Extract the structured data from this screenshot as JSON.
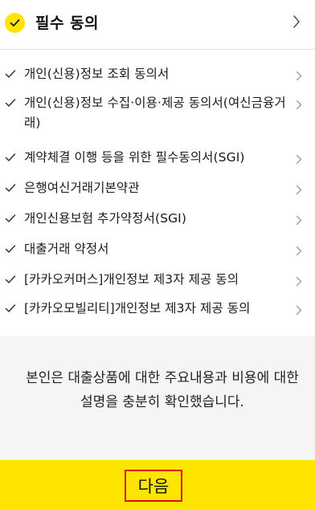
{
  "header": {
    "title": "필수 동의",
    "icons": {
      "check": "check-circle-icon",
      "expand": "chevron-right-icon"
    }
  },
  "agreements": [
    {
      "label": "개인(신용)정보 조회 동의서"
    },
    {
      "label": "개인(신용)정보 수집·이용·제공 동의서(여신금융거래)"
    },
    {
      "label": "계약체결 이행 등을 위한 필수동의서(SGI)"
    },
    {
      "label": "은행여신거래기본약관"
    },
    {
      "label": "개인신용보험 추가약정서(SGI)"
    },
    {
      "label": "대출거래 약정서"
    },
    {
      "label": "[카카오커머스]개인정보 제3자 제공 동의"
    },
    {
      "label": "[카카오모빌리티]개인정보 제3자 제공 동의"
    }
  ],
  "notice": {
    "line1": "본인은 대출상품에 대한 주요내용과 비용에 대한",
    "line2": "설명을 충분히 확인했습니다."
  },
  "footer": {
    "next_label": "다음"
  },
  "colors": {
    "accent": "#fee500",
    "highlight_border": "#e3001b",
    "notice_bg": "#f5f5f5"
  }
}
